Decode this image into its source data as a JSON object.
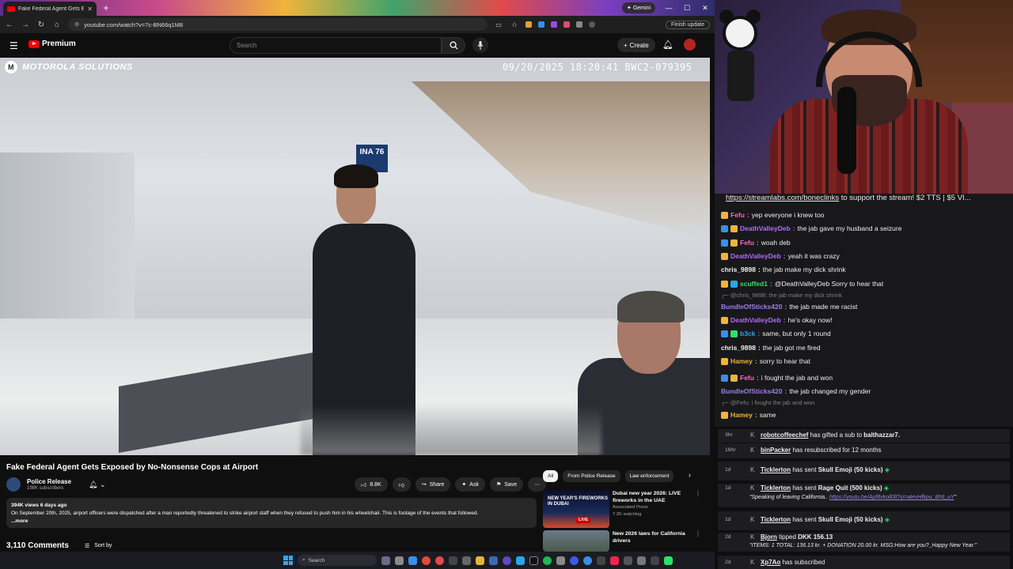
{
  "browser": {
    "tab_title": "Fake Federal Agent Gets Expos",
    "gemini": "Gemini",
    "url": "youtube.com/watch?v=7c-BN66q1M8",
    "finish_update": "Finish update"
  },
  "youtube": {
    "brand": "Premium",
    "search_placeholder": "Search",
    "create_label": "Create",
    "video": {
      "overlay_brand": "MOTOROLA SOLUTIONS",
      "overlay_logo_letter": "M",
      "timestamp": "09/20/2025 18:20:41 BWC2-079395",
      "sign_text": "INA 76"
    },
    "title": "Fake Federal Agent Gets Exposed by No-Nonsense Cops at Airport",
    "channel": {
      "name": "Police Release",
      "subscribers": "198K subscribers"
    },
    "actions": {
      "likes": "8.8K",
      "share": "Share",
      "ask": "Ask",
      "save": "Save"
    },
    "description": {
      "meta": "394K views  6 days ago",
      "text": "On September 20th, 2025, airport officers were dispatched after a man reportedly threatened to strike airport staff when they refused to push him in his wheelchair. This is footage of the events that followed.",
      "more": "...more"
    },
    "comments": {
      "count": "3,110 Comments",
      "sort": "Sort by"
    },
    "chips": [
      "All",
      "From Police Release",
      "Law enforcement"
    ],
    "recs": [
      {
        "title": "Dubai new year 2026: LIVE fireworks in the UAE",
        "channel": "Associated Press",
        "stat": "7.2K watching",
        "thumb_text": "NEW YEAR'S FIREWORKS IN DUBAI",
        "badge": "LIVE"
      },
      {
        "title": "New 2026 laws for California drivers",
        "channel": "",
        "stat": "",
        "thumb_text": "",
        "badge": ""
      }
    ]
  },
  "taskbar": {
    "search": "Search"
  },
  "chat": {
    "banner_link": "https://streamlabs.com/boneclinks",
    "banner_rest": " to support the stream! $2 TTS | $5 VI...",
    "messages": [
      {
        "user": "Fefu",
        "text": "yep everyone i knew too",
        "color": "#ff69b4",
        "badges": [
          "#f0b43a"
        ]
      },
      {
        "user": "DeathValleyDeb",
        "text": "the jab gave my husband a seizure",
        "color": "#b36bff",
        "badges": [
          "#3a8ee6",
          "#f0b43a"
        ]
      },
      {
        "user": "Fefu",
        "text": "woah deb",
        "color": "#ff69b4",
        "badges": [
          "#3a8ee6",
          "#f0b43a"
        ]
      },
      {
        "user": "DeathValleyDeb",
        "text": "yeah it was crazy",
        "color": "#b36bff",
        "badges": [
          "#f0b43a"
        ]
      },
      {
        "user": "chris_9898",
        "text": "the jab make my dick shrink",
        "color": "#efeff1",
        "badges": []
      },
      {
        "user": "scuffed1",
        "text": "@DeathValleyDeb Sorry to hear that",
        "color": "#2ee06b",
        "badges": [
          "#f0b43a",
          "#2aa6e6"
        ]
      },
      {
        "user": "BundleOfSticks420",
        "text": "the jab made me racist",
        "color": "#9c7fe8",
        "badges": []
      },
      {
        "user": "DeathValleyDeb",
        "text": "he's okay now!",
        "color": "#b36bff",
        "badges": [
          "#f0b43a"
        ]
      },
      {
        "user": "b3ck",
        "text": "same, but only 1 round",
        "color": "#2aa6e6",
        "badges": [
          "#3a8ee6",
          "#2ee06b"
        ]
      },
      {
        "user": "chris_9898",
        "text": "the jab got me fired",
        "color": "#efeff1",
        "badges": []
      },
      {
        "user": "Hamey",
        "text": "sorry to hear that",
        "color": "#f0b43a",
        "badges": [
          "#f0b43a"
        ]
      },
      {
        "user": "Fefu",
        "text": "i fought the jab and won",
        "color": "#ff69b4",
        "badges": [
          "#3a8ee6",
          "#f0b43a"
        ]
      },
      {
        "user": "BundleOfSticks420",
        "text": "the jab changed my gender",
        "color": "#9c7fe8",
        "badges": []
      },
      {
        "user": "Hamey",
        "text": "same",
        "color": "#f0b43a",
        "badges": [
          "#f0b43a"
        ]
      }
    ],
    "replies": [
      "@chris_9898: the jab make my dick shrink",
      "@Fefu: i fought the jab and won"
    ]
  },
  "events": [
    {
      "time": "3hr",
      "user": "robotcoffeechef",
      "text": " has gifted a sub to ",
      "target": "balthazzar7.",
      "sub": ""
    },
    {
      "time": "16hr",
      "user": "binPacker",
      "text": " has resubscribed for 12 months",
      "target": "",
      "sub": ""
    },
    {
      "time": "1d",
      "user": "Ticklerton",
      "text": " has sent ",
      "target": "Skull Emoji (50 kicks)",
      "sub": ""
    },
    {
      "time": "1d",
      "user": "Ticklerton",
      "text": " has sent ",
      "target": "Rage Quit (500 kicks)",
      "sub_prefix": "\"Speaking of leaving California.. ",
      "sub_link": "https://youtu.be/Apf8vkoll0ll?si=atevHfkpu_BNt_uY",
      "sub_suffix": "\""
    },
    {
      "time": "1d",
      "user": "Ticklerton",
      "text": " has sent ",
      "target": "Skull Emoji (50 kicks)",
      "sub": ""
    },
    {
      "time": "2d",
      "user": "Bjorn",
      "text": " tipped ",
      "target": "DKK 156.13",
      "sub_plain": "\"ITEMS: 1 TOTAL: 136.13 kr. + DONATION 20.00 kr. MSG:How are you?_Happy New Year.\""
    },
    {
      "time": "2d",
      "user": "Xp7Ao",
      "text": " has subscribed",
      "target": "",
      "sub": ""
    }
  ]
}
